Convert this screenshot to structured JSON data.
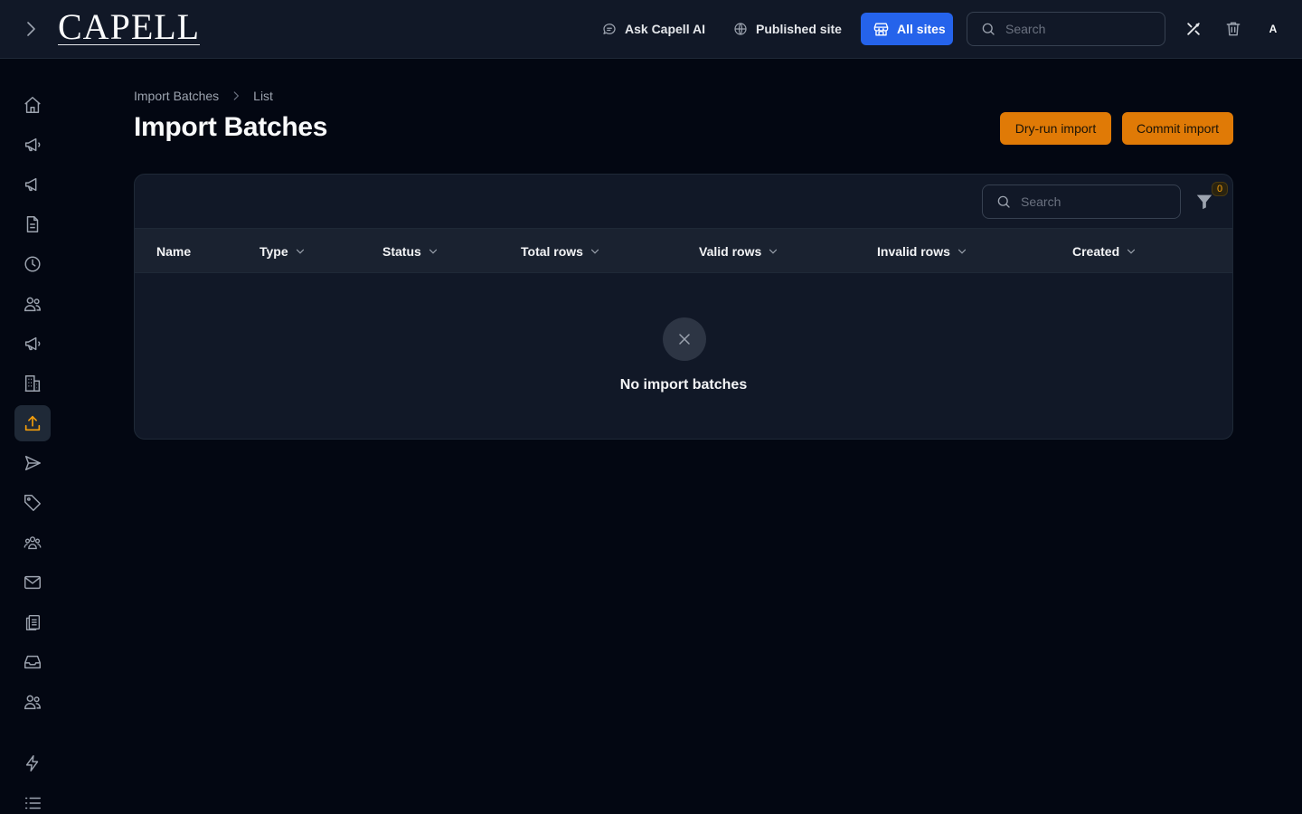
{
  "brand": "CAPELL",
  "topbar": {
    "ask_ai": "Ask Capell AI",
    "published_site": "Published site",
    "all_sites": "All sites",
    "search_placeholder": "Search",
    "avatar_initial": "A"
  },
  "sidebar": {
    "items": [
      {
        "icon": "home-icon"
      },
      {
        "icon": "megaphone-icon"
      },
      {
        "icon": "megaphone-icon"
      },
      {
        "icon": "document-icon"
      },
      {
        "icon": "clock-icon"
      },
      {
        "icon": "users-icon"
      },
      {
        "icon": "megaphone-icon"
      },
      {
        "icon": "building-icon"
      },
      {
        "icon": "upload-icon",
        "active": true
      },
      {
        "icon": "send-icon"
      },
      {
        "icon": "tag-icon"
      },
      {
        "icon": "user-group-icon"
      },
      {
        "icon": "envelope-icon"
      },
      {
        "icon": "clipboard-copy-icon"
      },
      {
        "icon": "inbox-icon"
      },
      {
        "icon": "users-icon"
      },
      {
        "icon": "bolt-icon"
      },
      {
        "icon": "list-icon"
      }
    ]
  },
  "breadcrumb": {
    "parent": "Import Batches",
    "current": "List"
  },
  "page": {
    "title": "Import Batches",
    "dry_run_label": "Dry-run import",
    "commit_label": "Commit import"
  },
  "table": {
    "search_placeholder": "Search",
    "filter_count": "0",
    "columns": [
      "Name",
      "Type",
      "Status",
      "Total rows",
      "Valid rows",
      "Invalid rows",
      "Created"
    ],
    "rows": [],
    "empty_text": "No import batches"
  },
  "colors": {
    "accent_orange": "#e07a06",
    "accent_blue": "#2563eb",
    "background": "#030712"
  }
}
